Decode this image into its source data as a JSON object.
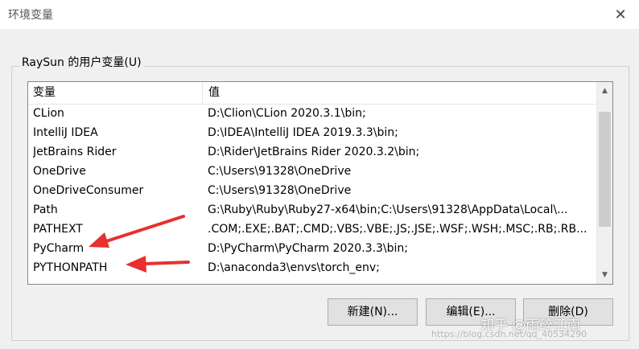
{
  "window": {
    "title": "环境变量",
    "close_glyph": "✕"
  },
  "group": {
    "label": "RaySun 的用户变量(U)"
  },
  "table": {
    "columns": [
      "变量",
      "值"
    ],
    "rows": [
      {
        "name": "CLion",
        "value": "D:\\Clion\\CLion 2020.3.1\\bin;"
      },
      {
        "name": "IntelliJ IDEA",
        "value": "D:\\IDEA\\IntelliJ IDEA 2019.3.3\\bin;"
      },
      {
        "name": "JetBrains Rider",
        "value": "D:\\Rider\\JetBrains Rider 2020.3.2\\bin;"
      },
      {
        "name": "OneDrive",
        "value": "C:\\Users\\91328\\OneDrive"
      },
      {
        "name": "OneDriveConsumer",
        "value": "C:\\Users\\91328\\OneDrive"
      },
      {
        "name": "Path",
        "value": "G:\\Ruby\\Ruby\\Ruby27-x64\\bin;C:\\Users\\91328\\AppData\\Local\\..."
      },
      {
        "name": "PATHEXT",
        "value": ".COM;.EXE;.BAT;.CMD;.VBS;.VBE;.JS;.JSE;.WSF;.WSH;.MSC;.RB;.RB..."
      },
      {
        "name": "PyCharm",
        "value": "D:\\PyCharm\\PyCharm 2020.3.3\\bin;"
      },
      {
        "name": "PYTHONPATH",
        "value": "D:\\anaconda3\\envs\\torch_env;"
      }
    ]
  },
  "scrollbar": {
    "up_glyph": "▲",
    "down_glyph": "▼"
  },
  "buttons": {
    "new_label": "新建(N)...",
    "edit_label": "编辑(E)...",
    "delete_label": "删除(D)"
  },
  "annotation": {
    "arrow_color": "#e83030"
  },
  "watermark": {
    "main": "知乎 @雨碎江南",
    "sub": "https://blog.csdn.net/qq_40534290"
  }
}
